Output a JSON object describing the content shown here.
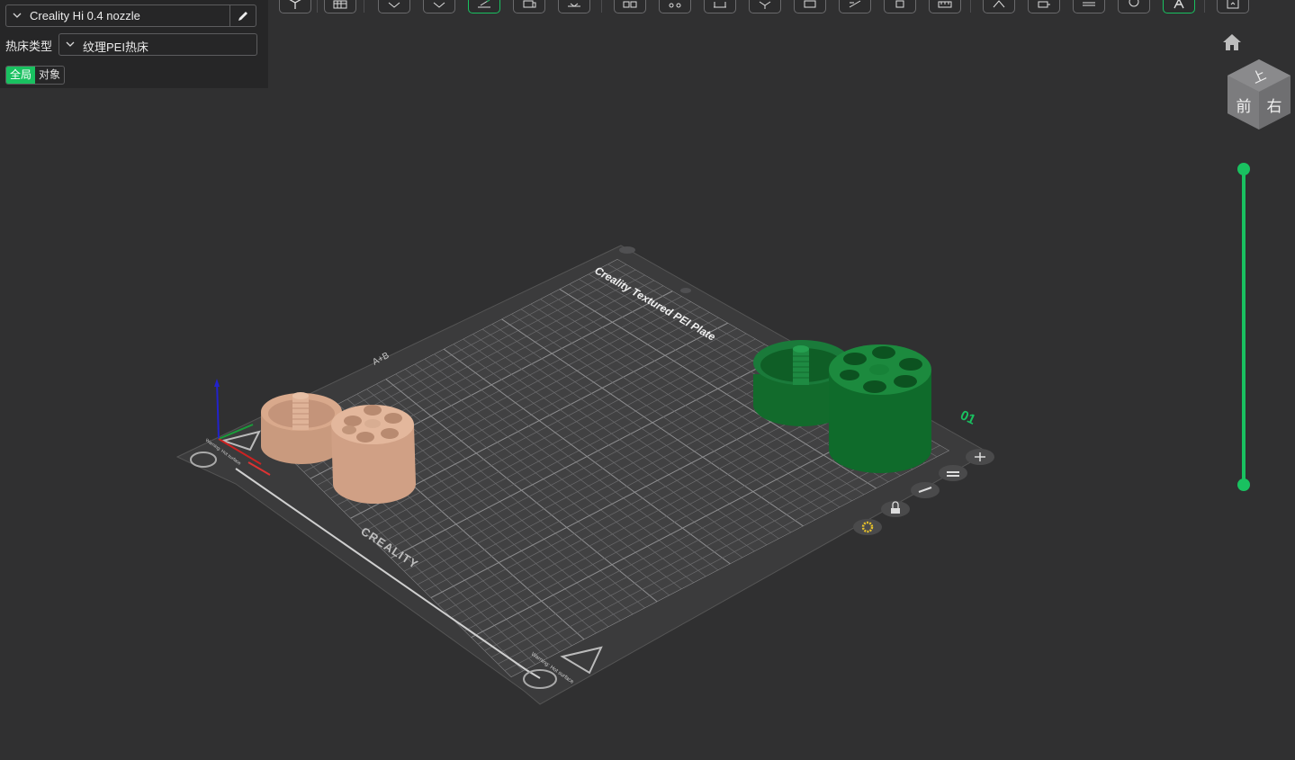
{
  "printer": {
    "name": "Creality Hi 0.4 nozzle"
  },
  "bed": {
    "label": "热床类型",
    "value": "纹理PEI热床"
  },
  "scope_tabs": [
    {
      "label": "全局",
      "active": true
    },
    {
      "label": "对象",
      "active": false
    }
  ],
  "toolbar": {
    "tools": [
      "add-cube-icon",
      "grid-arrange-icon",
      "split-icon",
      "lay-flat-icon",
      "auto-orient-icon",
      "arrange-icon",
      "slice-plate-icon",
      "objects-icon",
      "settings-icon",
      "measure-icon",
      "shell-icon",
      "paint-icon",
      "seam-icon",
      "support-icon",
      "cut-icon",
      "variable-layer-icon",
      "text-icon",
      "emboss-icon",
      "assembly-icon",
      "brim-ear-icon",
      "export-icon"
    ],
    "active_color": "#19c160"
  },
  "scene": {
    "plate_label": "Creality Textured PEI Plate",
    "brand": "CREALITY",
    "plate_number": "01",
    "origin_label": "A+B",
    "warning_text": "Warning: Hot surface",
    "model_colors": {
      "tan": "#d9a98c",
      "green": "#1a7a3a"
    }
  },
  "viewcube": {
    "top": "上",
    "front": "前",
    "right": "右"
  },
  "layer_slider": {
    "color": "#19c160"
  }
}
